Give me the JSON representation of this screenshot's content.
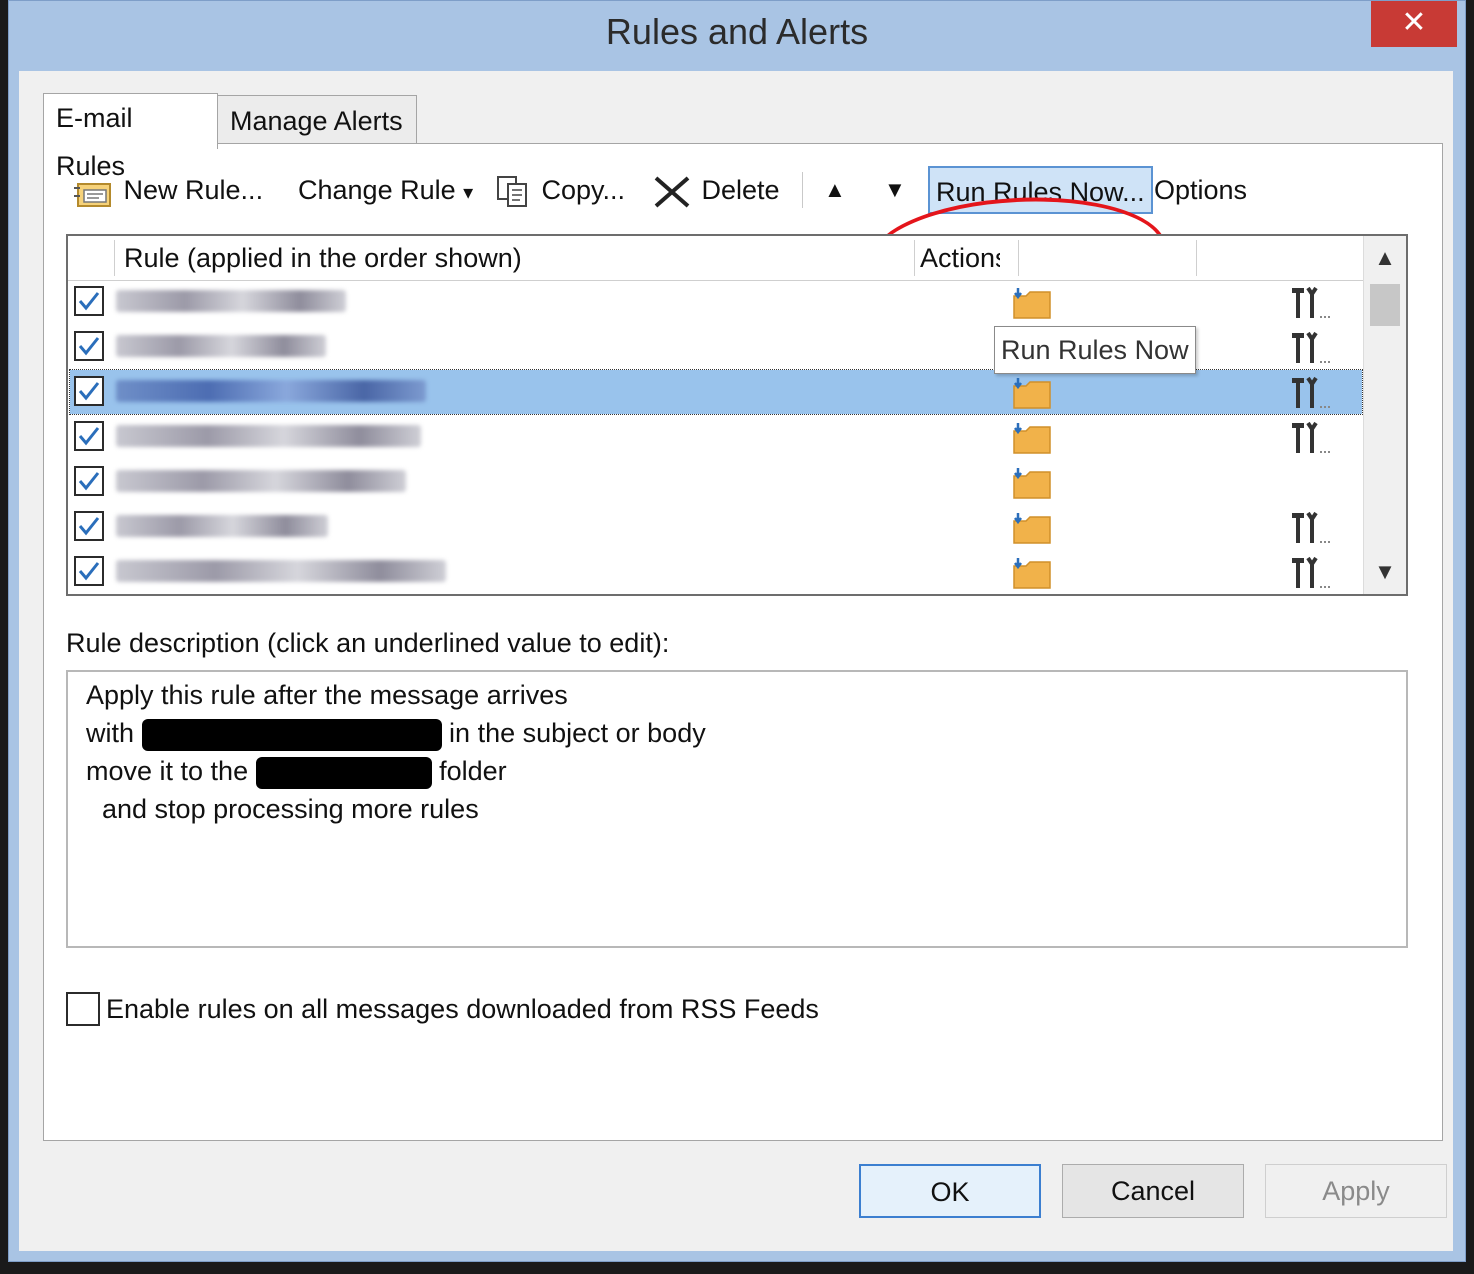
{
  "window": {
    "title": "Rules and Alerts",
    "close_glyph": "✕"
  },
  "tabs": [
    {
      "label": "E-mail Rules",
      "active": true
    },
    {
      "label": "Manage Alerts",
      "active": false
    }
  ],
  "toolbar": {
    "new_rule": "New Rule...",
    "change_rule": "Change Rule",
    "change_rule_arrow": "▾",
    "copy": "Copy...",
    "delete": "Delete",
    "move_up": "▲",
    "move_down": "▼",
    "run_rules_now": "Run Rules Now...",
    "options": "Options"
  },
  "rules_list": {
    "columns": [
      "Rule (applied in the order shown)",
      "Actions"
    ],
    "tooltip": "Run Rules Now",
    "scroll_up": "▲",
    "scroll_down": "▼",
    "rows": [
      {
        "checked": true,
        "selected": false,
        "has_tools": true
      },
      {
        "checked": true,
        "selected": false,
        "has_tools": true
      },
      {
        "checked": true,
        "selected": true,
        "has_tools": true
      },
      {
        "checked": true,
        "selected": false,
        "has_tools": true
      },
      {
        "checked": true,
        "selected": false,
        "has_tools": false
      },
      {
        "checked": true,
        "selected": false,
        "has_tools": true
      },
      {
        "checked": true,
        "selected": false,
        "has_tools": true
      }
    ]
  },
  "description": {
    "label": "Rule description (click an underlined value to edit):",
    "line1": "Apply this rule after the message arrives",
    "line2_pre": "with",
    "line2_post": "in the subject or body",
    "line3_pre": "move it to the",
    "line3_post": "folder",
    "line4": "and stop processing more rules"
  },
  "rss": {
    "label": "Enable rules on all messages downloaded from RSS Feeds",
    "checked": false
  },
  "buttons": {
    "ok": "OK",
    "cancel": "Cancel",
    "apply": "Apply"
  },
  "colors": {
    "accent": "#3c7fd0",
    "selection": "#99c3ec",
    "highlight_circle": "#e4151b",
    "titlebar": "#a9c4e4",
    "close": "#c83a35"
  }
}
